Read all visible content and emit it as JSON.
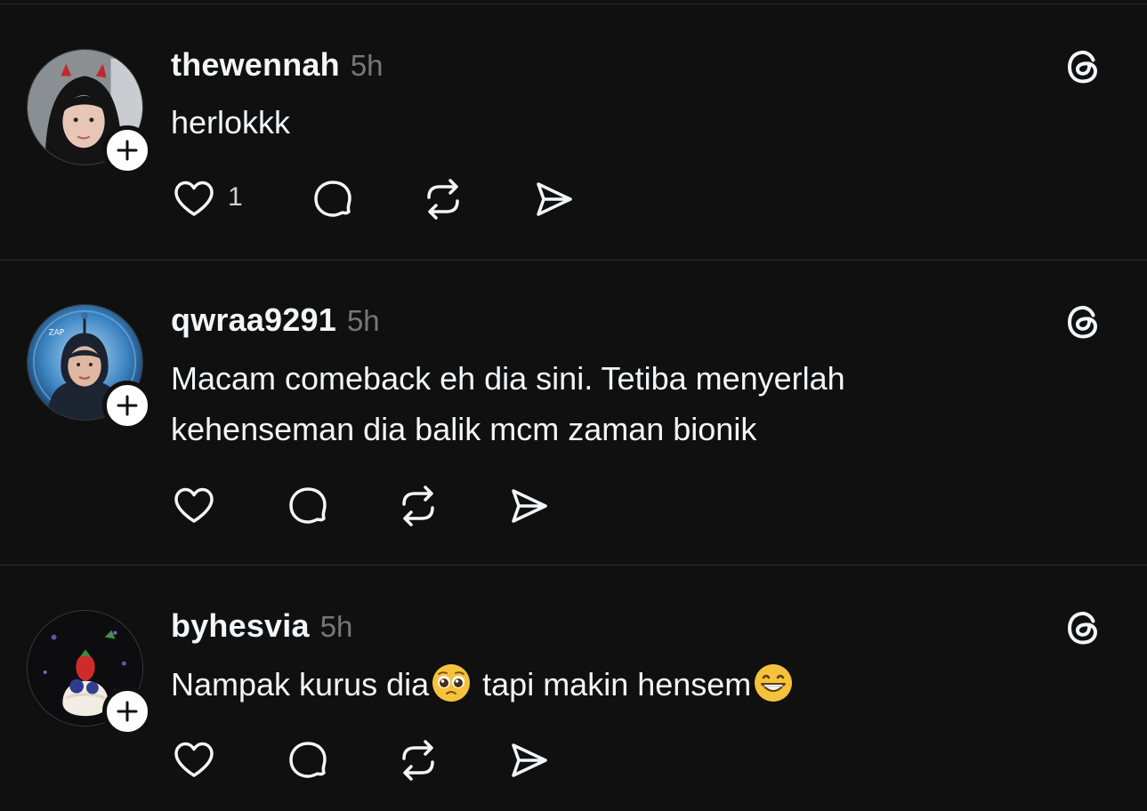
{
  "posts": [
    {
      "username": "thewennah",
      "time": "5h",
      "text_lines": [
        "herlokkk"
      ],
      "like_count": "1",
      "avatar_icon": "avatar-photo",
      "follow_icon": "plus-icon"
    },
    {
      "username": "qwraa9291",
      "time": "5h",
      "text_lines": [
        "Macam comeback eh dia sini. Tetiba menyerlah",
        "kehenseman dia balik mcm zaman bionik"
      ],
      "like_count": "",
      "avatar_icon": "avatar-photo",
      "follow_icon": "plus-icon"
    },
    {
      "username": "byhesvia",
      "time": "5h",
      "text_segments": [
        "Nampak kurus dia",
        " tapi makin hensem"
      ],
      "emojis": [
        "pleading-face",
        "grinning-face"
      ],
      "like_count": "",
      "avatar_icon": "avatar-photo",
      "follow_icon": "plus-icon"
    }
  ],
  "icons": {
    "like": "heart-icon",
    "reply": "comment-icon",
    "repost": "repost-icon",
    "share": "send-icon",
    "brand": "threads-logo-icon"
  },
  "colors": {
    "background": "#101010",
    "text": "#f3f5f7",
    "muted": "#777777",
    "divider": "#2e2e2e"
  }
}
